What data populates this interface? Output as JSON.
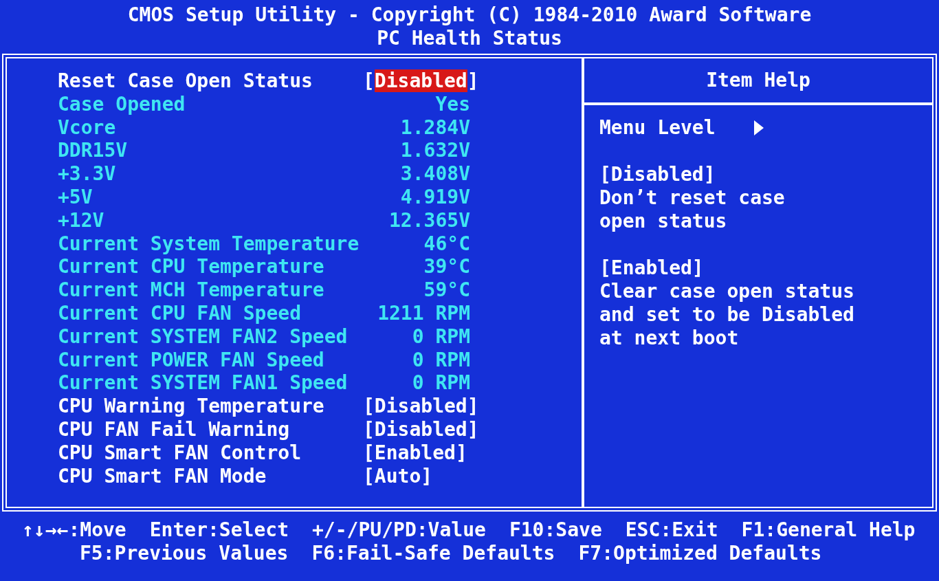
{
  "header": {
    "title": "CMOS Setup Utility - Copyright (C) 1984-2010 Award Software",
    "subtitle": "PC Health Status"
  },
  "items": [
    {
      "kind": "setting",
      "label": "Reset Case Open Status",
      "open": "[",
      "value": "Disabled",
      "close": "]",
      "selected": true
    },
    {
      "kind": "info",
      "label": "Case Opened",
      "value": "Yes"
    },
    {
      "kind": "info",
      "label": "Vcore",
      "value": "1.284V"
    },
    {
      "kind": "info",
      "label": "DDR15V",
      "value": "1.632V"
    },
    {
      "kind": "info",
      "label": "+3.3V",
      "value": "3.408V"
    },
    {
      "kind": "info",
      "label": "+5V",
      "value": "4.919V"
    },
    {
      "kind": "info",
      "label": "+12V",
      "value": "12.365V"
    },
    {
      "kind": "info",
      "label": "Current System Temperature",
      "value": "46°C"
    },
    {
      "kind": "info",
      "label": "Current CPU Temperature",
      "value": "39°C"
    },
    {
      "kind": "info",
      "label": "Current MCH Temperature",
      "value": "59°C"
    },
    {
      "kind": "info",
      "label": "Current CPU FAN Speed",
      "value": "1211 RPM"
    },
    {
      "kind": "info",
      "label": "Current SYSTEM FAN2 Speed",
      "value": "0 RPM"
    },
    {
      "kind": "info",
      "label": "Current POWER FAN Speed",
      "value": "0 RPM"
    },
    {
      "kind": "info",
      "label": "Current SYSTEM FAN1 Speed",
      "value": "0 RPM"
    },
    {
      "kind": "setting",
      "label": "CPU Warning Temperature",
      "open": "[",
      "value": "Disabled",
      "close": "]",
      "selected": false
    },
    {
      "kind": "setting",
      "label": "CPU FAN Fail Warning",
      "open": "[",
      "value": "Disabled",
      "close": "]",
      "selected": false
    },
    {
      "kind": "setting",
      "label": "CPU Smart FAN Control",
      "open": "[",
      "value": "Enabled",
      "close": "]",
      "selected": false
    },
    {
      "kind": "setting",
      "label": "CPU Smart FAN Mode",
      "open": "[",
      "value": "Auto",
      "close": "]",
      "selected": false
    }
  ],
  "help": {
    "title": "Item Help",
    "menu_level": "Menu Level",
    "sections": [
      {
        "heading": "[Disabled]",
        "lines": [
          "Don’t reset case",
          "open status"
        ]
      },
      {
        "heading": "[Enabled]",
        "lines": [
          "Clear case open status",
          "and set to be Disabled",
          "at next boot"
        ]
      }
    ]
  },
  "footer": {
    "lines": [
      [
        "↑↓→←:Move",
        "Enter:Select",
        "+/-/PU/PD:Value",
        "F10:Save",
        "ESC:Exit",
        "F1:General Help"
      ],
      [
        "F5:Previous Values",
        "F6:Fail-Safe Defaults",
        "F7:Optimized Defaults"
      ]
    ]
  }
}
